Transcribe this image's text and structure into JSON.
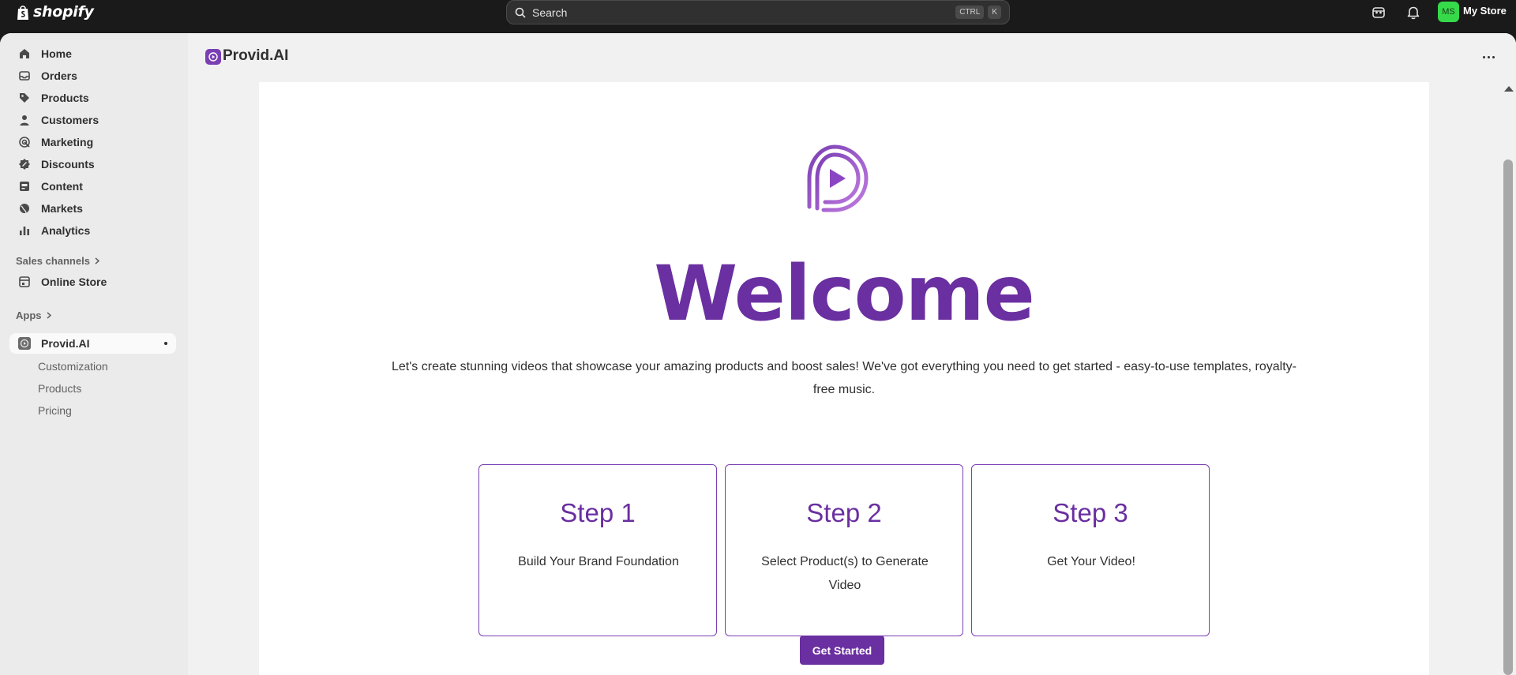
{
  "topbar": {
    "brand": "shopify",
    "search_placeholder": "Search",
    "shortcut_keys": [
      "CTRL",
      "K"
    ],
    "avatar_initials": "MS",
    "store_name": "My Store"
  },
  "sidebar": {
    "items": [
      {
        "label": "Home",
        "icon": "home-icon"
      },
      {
        "label": "Orders",
        "icon": "inbox-icon"
      },
      {
        "label": "Products",
        "icon": "tag-icon"
      },
      {
        "label": "Customers",
        "icon": "person-icon"
      },
      {
        "label": "Marketing",
        "icon": "target-icon"
      },
      {
        "label": "Discounts",
        "icon": "discount-icon"
      },
      {
        "label": "Content",
        "icon": "content-icon"
      },
      {
        "label": "Markets",
        "icon": "globe-icon"
      },
      {
        "label": "Analytics",
        "icon": "bar-chart-icon"
      }
    ],
    "sales_channels_label": "Sales channels",
    "online_store_label": "Online Store",
    "apps_label": "Apps",
    "active_app_label": "Provid.AI",
    "app_sub_items": [
      "Customization",
      "Products",
      "Pricing"
    ]
  },
  "app": {
    "title": "Provid.AI",
    "welcome": "Welcome",
    "intro": "Let's create stunning videos that showcase your amazing products and boost sales! We've got everything you need to get started - easy-to-use templates, royalty-free music.",
    "steps": [
      {
        "title": "Step 1",
        "desc": "Build Your Brand Foundation"
      },
      {
        "title": "Step 2",
        "desc": "Select Product(s) to Generate Video"
      },
      {
        "title": "Step 3",
        "desc": "Get Your Video!"
      }
    ],
    "cta_label": "Get Started"
  },
  "colors": {
    "brand_purple": "#6a2fa0",
    "topbar_bg": "#1a1a1a",
    "avatar_green": "#36d94a"
  }
}
